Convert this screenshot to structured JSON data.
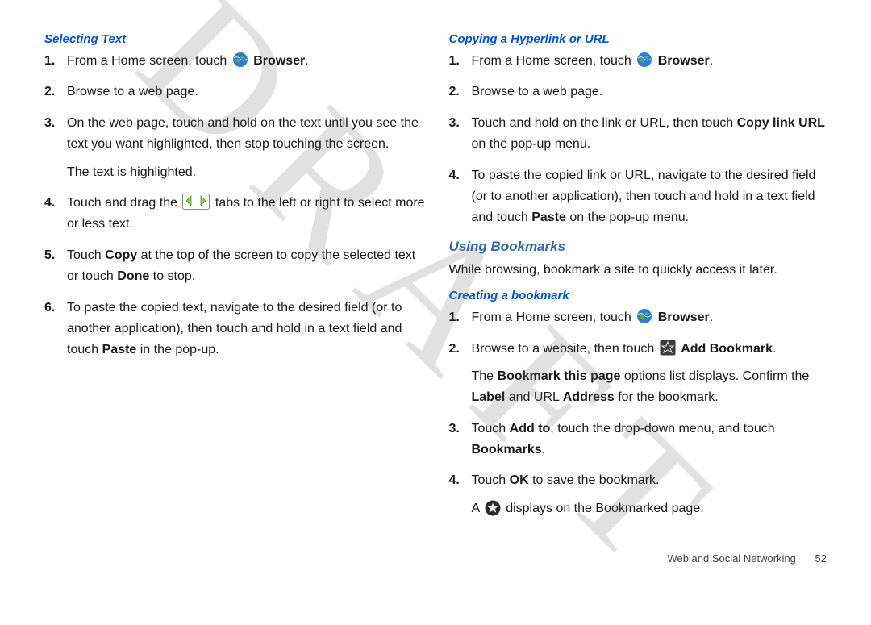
{
  "watermark": "DRAFT",
  "footer": {
    "section": "Web and Social Networking",
    "page": "52"
  },
  "left": {
    "heading": "Selecting Text",
    "s1_a": "From a Home screen, touch ",
    "s1_b": "Browser",
    "s1_c": ".",
    "s2": "Browse to a web page.",
    "s3": "On the web page, touch and hold on the text until you see the text you want highlighted, then stop touching the screen.",
    "s3_after": "The text is highlighted.",
    "s4_a": "Touch and drag the ",
    "s4_b": " tabs to the left or right to select more or less text.",
    "s5_a": "Touch ",
    "s5_b": "Copy",
    "s5_c": " at the top of the screen to copy the selected text or touch ",
    "s5_d": "Done",
    "s5_e": " to stop.",
    "s6_a": "To paste the copied text, navigate to the desired field (or to another application), then touch and hold in a text field and touch ",
    "s6_b": "Paste",
    "s6_c": " in the pop-up."
  },
  "right": {
    "heading1": "Copying a Hyperlink or URL",
    "r1_a": "From a Home screen, touch ",
    "r1_b": "Browser",
    "r1_c": ".",
    "r2": "Browse to a web page.",
    "r3_a": "Touch and hold on the link or URL, then touch ",
    "r3_b": "Copy link URL",
    "r3_c": " on the pop-up menu.",
    "r4_a": "To paste the copied link or URL, navigate to the desired field (or to another application), then touch and hold in a text field and touch ",
    "r4_b": "Paste",
    "r4_c": " on the pop-up menu.",
    "heading2": "Using Bookmarks",
    "intro": "While browsing, bookmark a site to quickly access it later.",
    "heading3": "Creating a bookmark",
    "b1_a": "From a Home screen, touch ",
    "b1_b": "Browser",
    "b1_c": ".",
    "b2_a": "Browse to a website, then touch ",
    "b2_b": "Add Bookmark",
    "b2_c": ".",
    "b2_after_a": "The ",
    "b2_after_b": "Bookmark this page",
    "b2_after_c": " options list displays. Confirm the ",
    "b2_after_d": "Label",
    "b2_after_e": " and URL ",
    "b2_after_f": "Address",
    "b2_after_g": " for the bookmark.",
    "b3_a": "Touch ",
    "b3_b": "Add to",
    "b3_c": ", touch the drop-down menu, and touch ",
    "b3_d": "Bookmarks",
    "b3_e": ".",
    "b4_a": "Touch ",
    "b4_b": "OK",
    "b4_c": " to save the bookmark.",
    "b4_after_a": "A ",
    "b4_after_b": " displays on the Bookmarked page."
  },
  "nums": {
    "n1": "1.",
    "n2": "2.",
    "n3": "3.",
    "n4": "4.",
    "n5": "5.",
    "n6": "6."
  }
}
